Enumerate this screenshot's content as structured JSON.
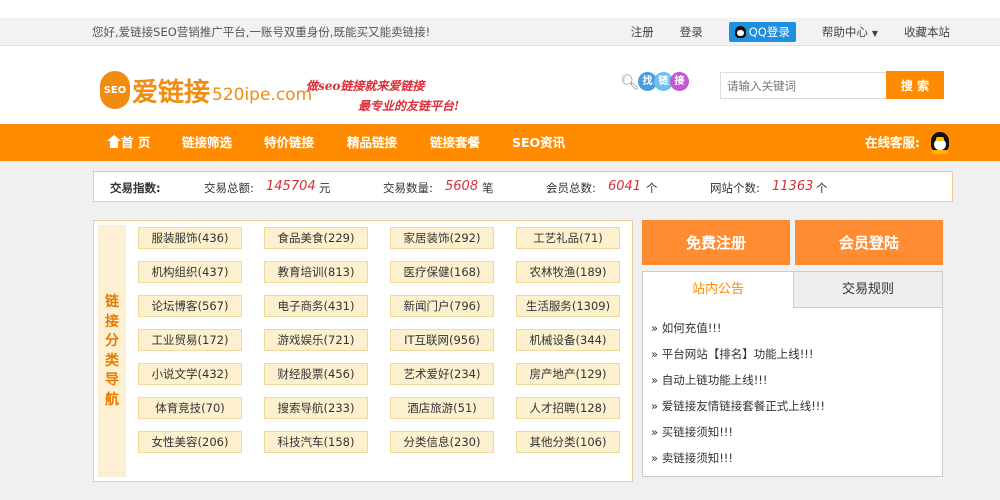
{
  "topbar": {
    "welcome": "您好,爱链接SEO营销推广平台,一账号双重身份,既能买又能卖链接!",
    "register": "注册",
    "login": "登录",
    "qq_login": "QQ登录",
    "help": "帮助中心",
    "favorite": "收藏本站"
  },
  "header": {
    "logo_seo": "SEO",
    "logo_cn": "爱链接",
    "logo_url": "520ipe.com",
    "slogan_line1": "做seo链接就来爱链接",
    "slogan_line2": "最专业的友链平台!",
    "find_chars": [
      "找",
      "链",
      "接"
    ],
    "find_colors": [
      "#4a9be0",
      "#6cc0f0",
      "#c05ad0"
    ],
    "search_placeholder": "请输入关键词",
    "search_button": "搜 索"
  },
  "nav": {
    "items": [
      "首 页",
      "链接筛选",
      "特价链接",
      "精品链接",
      "链接套餐",
      "SEO资讯"
    ],
    "service": "在线客服:"
  },
  "stats": {
    "label": "交易指数:",
    "total_amount_label": "交易总额:",
    "total_amount": "145704",
    "total_amount_unit": "元",
    "count_label": "交易数量:",
    "count": "5608",
    "count_unit": "笔",
    "members_label": "会员总数:",
    "members": "6041",
    "members_unit": "个",
    "sites_label": "网站个数:",
    "sites": "11363",
    "sites_unit": "个"
  },
  "categories": {
    "side_title": "链接分类导航",
    "items": [
      "服装服饰(436)",
      "食品美食(229)",
      "家居装饰(292)",
      "工艺礼品(71)",
      "机构组织(437)",
      "教育培训(813)",
      "医疗保健(168)",
      "农林牧渔(189)",
      "论坛博客(567)",
      "电子商务(431)",
      "新闻门户(796)",
      "生活服务(1309)",
      "工业贸易(172)",
      "游戏娱乐(721)",
      "IT互联网(956)",
      "机械设备(344)",
      "小说文学(432)",
      "财经股票(456)",
      "艺术爱好(234)",
      "房产地产(129)",
      "体育竞技(70)",
      "搜索导航(233)",
      "酒店旅游(51)",
      "人才招聘(128)",
      "女性美容(206)",
      "科技汽车(158)",
      "分类信息(230)",
      "其他分类(106)"
    ]
  },
  "side": {
    "free_register": "免费注册",
    "member_login": "会员登陆",
    "tabs": [
      "站内公告",
      "交易规则"
    ],
    "notices": [
      "» 如何充值!!!",
      "» 平台网站【排名】功能上线!!!",
      "» 自动上链功能上线!!!",
      "» 爱链接友情链接套餐正式上线!!!",
      "» 买链接须知!!!",
      "» 卖链接须知!!!"
    ]
  }
}
